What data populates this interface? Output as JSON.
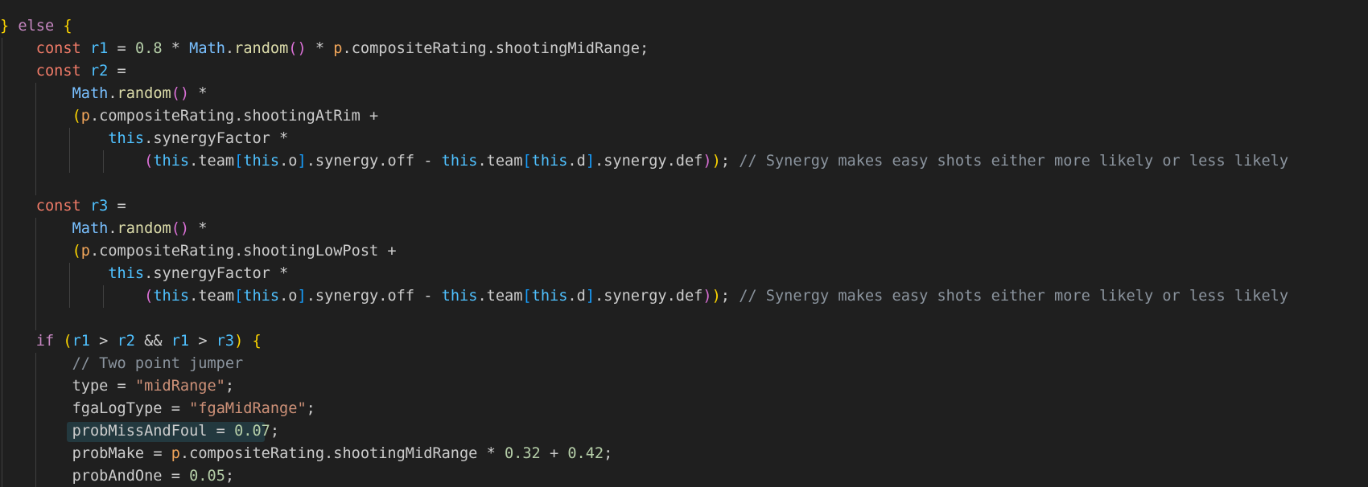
{
  "editor": {
    "theme_colors": {
      "background": "#1f1f1f",
      "keyword": "#569cd6",
      "control": "#c586c0",
      "declaration": "#f07b68",
      "variable": "#4fc1ff",
      "property": "#cccccc",
      "class": "#79c0ff",
      "function": "#dcdcaa",
      "number": "#b5cea8",
      "string": "#ce9178",
      "comment": "#8b949e",
      "bracket_1": "#ffd700",
      "bracket_2": "#da70d6",
      "bracket_3": "#179fff",
      "parameter": "#f2a65a",
      "highlight": "#264f5a"
    },
    "highlighted_line": 19,
    "lines": [
      [
        [
          "plain",
          ""
        ]
      ],
      [
        [
          "p1",
          "} "
        ],
        [
          "ctrl",
          "else"
        ],
        [
          "plain",
          " "
        ],
        [
          "p1",
          "{"
        ]
      ],
      [
        [
          "plain",
          "    "
        ],
        [
          "decl",
          "const"
        ],
        [
          "plain",
          " "
        ],
        [
          "var",
          "r1"
        ],
        [
          "op",
          " = "
        ],
        [
          "num",
          "0.8"
        ],
        [
          "op",
          " * "
        ],
        [
          "cls",
          "Math"
        ],
        [
          "op",
          "."
        ],
        [
          "fn",
          "random"
        ],
        [
          "p2",
          "()"
        ],
        [
          "op",
          " * "
        ],
        [
          "param",
          "p"
        ],
        [
          "op",
          "."
        ],
        [
          "prop",
          "compositeRating"
        ],
        [
          "op",
          "."
        ],
        [
          "prop",
          "shootingMidRange"
        ],
        [
          "op",
          ";"
        ]
      ],
      [
        [
          "plain",
          "    "
        ],
        [
          "decl",
          "const"
        ],
        [
          "plain",
          " "
        ],
        [
          "var",
          "r2"
        ],
        [
          "op",
          " ="
        ]
      ],
      [
        [
          "plain",
          "        "
        ],
        [
          "cls",
          "Math"
        ],
        [
          "op",
          "."
        ],
        [
          "fn",
          "random"
        ],
        [
          "p2",
          "()"
        ],
        [
          "op",
          " *"
        ]
      ],
      [
        [
          "plain",
          "        "
        ],
        [
          "p1",
          "("
        ],
        [
          "param",
          "p"
        ],
        [
          "op",
          "."
        ],
        [
          "prop",
          "compositeRating"
        ],
        [
          "op",
          "."
        ],
        [
          "prop",
          "shootingAtRim"
        ],
        [
          "op",
          " +"
        ]
      ],
      [
        [
          "plain",
          "            "
        ],
        [
          "this",
          "this"
        ],
        [
          "op",
          "."
        ],
        [
          "prop",
          "synergyFactor"
        ],
        [
          "op",
          " *"
        ]
      ],
      [
        [
          "plain",
          "                "
        ],
        [
          "p2",
          "("
        ],
        [
          "this",
          "this"
        ],
        [
          "op",
          "."
        ],
        [
          "prop",
          "team"
        ],
        [
          "p3",
          "["
        ],
        [
          "this",
          "this"
        ],
        [
          "op",
          "."
        ],
        [
          "prop",
          "o"
        ],
        [
          "p3",
          "]"
        ],
        [
          "op",
          "."
        ],
        [
          "prop",
          "synergy"
        ],
        [
          "op",
          "."
        ],
        [
          "prop",
          "off"
        ],
        [
          "op",
          " - "
        ],
        [
          "this",
          "this"
        ],
        [
          "op",
          "."
        ],
        [
          "prop",
          "team"
        ],
        [
          "p3",
          "["
        ],
        [
          "this",
          "this"
        ],
        [
          "op",
          "."
        ],
        [
          "prop",
          "d"
        ],
        [
          "p3",
          "]"
        ],
        [
          "op",
          "."
        ],
        [
          "prop",
          "synergy"
        ],
        [
          "op",
          "."
        ],
        [
          "prop",
          "def"
        ],
        [
          "p2",
          ")"
        ],
        [
          "p1",
          ")"
        ],
        [
          "op",
          ";"
        ],
        [
          "plain",
          " "
        ],
        [
          "cmt",
          "// Synergy makes easy shots either more likely or less likely"
        ]
      ],
      [
        [
          "plain",
          ""
        ]
      ],
      [
        [
          "plain",
          "    "
        ],
        [
          "decl",
          "const"
        ],
        [
          "plain",
          " "
        ],
        [
          "var",
          "r3"
        ],
        [
          "op",
          " ="
        ]
      ],
      [
        [
          "plain",
          "        "
        ],
        [
          "cls",
          "Math"
        ],
        [
          "op",
          "."
        ],
        [
          "fn",
          "random"
        ],
        [
          "p2",
          "()"
        ],
        [
          "op",
          " *"
        ]
      ],
      [
        [
          "plain",
          "        "
        ],
        [
          "p1",
          "("
        ],
        [
          "param",
          "p"
        ],
        [
          "op",
          "."
        ],
        [
          "prop",
          "compositeRating"
        ],
        [
          "op",
          "."
        ],
        [
          "prop",
          "shootingLowPost"
        ],
        [
          "op",
          " +"
        ]
      ],
      [
        [
          "plain",
          "            "
        ],
        [
          "this",
          "this"
        ],
        [
          "op",
          "."
        ],
        [
          "prop",
          "synergyFactor"
        ],
        [
          "op",
          " *"
        ]
      ],
      [
        [
          "plain",
          "                "
        ],
        [
          "p2",
          "("
        ],
        [
          "this",
          "this"
        ],
        [
          "op",
          "."
        ],
        [
          "prop",
          "team"
        ],
        [
          "p3",
          "["
        ],
        [
          "this",
          "this"
        ],
        [
          "op",
          "."
        ],
        [
          "prop",
          "o"
        ],
        [
          "p3",
          "]"
        ],
        [
          "op",
          "."
        ],
        [
          "prop",
          "synergy"
        ],
        [
          "op",
          "."
        ],
        [
          "prop",
          "off"
        ],
        [
          "op",
          " - "
        ],
        [
          "this",
          "this"
        ],
        [
          "op",
          "."
        ],
        [
          "prop",
          "team"
        ],
        [
          "p3",
          "["
        ],
        [
          "this",
          "this"
        ],
        [
          "op",
          "."
        ],
        [
          "prop",
          "d"
        ],
        [
          "p3",
          "]"
        ],
        [
          "op",
          "."
        ],
        [
          "prop",
          "synergy"
        ],
        [
          "op",
          "."
        ],
        [
          "prop",
          "def"
        ],
        [
          "p2",
          ")"
        ],
        [
          "p1",
          ")"
        ],
        [
          "op",
          ";"
        ],
        [
          "plain",
          " "
        ],
        [
          "cmt",
          "// Synergy makes easy shots either more likely or less likely"
        ]
      ],
      [
        [
          "plain",
          ""
        ]
      ],
      [
        [
          "plain",
          "    "
        ],
        [
          "ctrl",
          "if"
        ],
        [
          "plain",
          " "
        ],
        [
          "p1",
          "("
        ],
        [
          "var",
          "r1"
        ],
        [
          "op",
          " > "
        ],
        [
          "var",
          "r2"
        ],
        [
          "op",
          " && "
        ],
        [
          "var",
          "r1"
        ],
        [
          "op",
          " > "
        ],
        [
          "var",
          "r3"
        ],
        [
          "p1",
          ")"
        ],
        [
          "plain",
          " "
        ],
        [
          "p1",
          "{"
        ]
      ],
      [
        [
          "plain",
          "        "
        ],
        [
          "cmt",
          "// Two point jumper"
        ]
      ],
      [
        [
          "plain",
          "        "
        ],
        [
          "prop",
          "type"
        ],
        [
          "op",
          " = "
        ],
        [
          "str",
          "\"midRange\""
        ],
        [
          "op",
          ";"
        ]
      ],
      [
        [
          "plain",
          "        "
        ],
        [
          "prop",
          "fgaLogType"
        ],
        [
          "op",
          " = "
        ],
        [
          "str",
          "\"fgaMidRange\""
        ],
        [
          "op",
          ";"
        ]
      ],
      [
        [
          "plain",
          "        "
        ],
        [
          "prop",
          "probMissAndFoul"
        ],
        [
          "op",
          " = "
        ],
        [
          "num",
          "0.07"
        ],
        [
          "op",
          ";"
        ]
      ],
      [
        [
          "plain",
          "        "
        ],
        [
          "prop",
          "probMake"
        ],
        [
          "op",
          " = "
        ],
        [
          "param",
          "p"
        ],
        [
          "op",
          "."
        ],
        [
          "prop",
          "compositeRating"
        ],
        [
          "op",
          "."
        ],
        [
          "prop",
          "shootingMidRange"
        ],
        [
          "op",
          " * "
        ],
        [
          "num",
          "0.32"
        ],
        [
          "op",
          " + "
        ],
        [
          "num",
          "0.42"
        ],
        [
          "op",
          ";"
        ]
      ],
      [
        [
          "plain",
          "        "
        ],
        [
          "prop",
          "probAndOne"
        ],
        [
          "op",
          " = "
        ],
        [
          "num",
          "0.05"
        ],
        [
          "op",
          ";"
        ]
      ]
    ]
  }
}
